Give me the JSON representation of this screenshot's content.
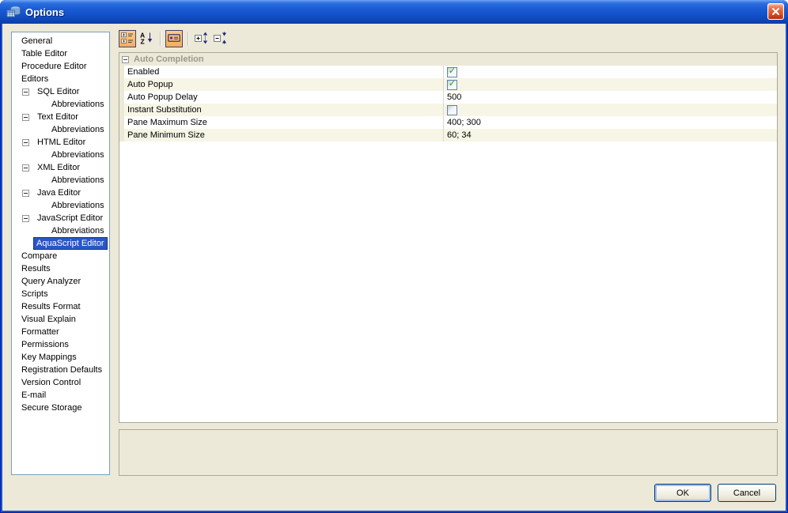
{
  "window": {
    "title": "Options"
  },
  "colors": {
    "titlebar_blue": "#1a55d2",
    "dialog_beige": "#ece9d8",
    "selection_blue": "#2a56c6",
    "toolbar_selected_orange": "#f6ad5c",
    "check_green": "#15a31b",
    "close_red": "#d84c20",
    "panel_border_gray": "#aca899",
    "tree_border_blue": "#7f9db9"
  },
  "icons": {
    "titlebar": "database-table-icon",
    "close": "close-x-icon",
    "tree_collapse": "minus-box-icon",
    "checkbox_checked": "green-check-icon",
    "toolbar": [
      "categorized-icon",
      "alphabetical-sort-icon",
      "show-description-icon",
      "expand-all-icon",
      "collapse-all-icon"
    ]
  },
  "toolbar": {
    "categorized_selected": true,
    "alphabetical_selected": false,
    "description_selected": true,
    "expand_selected": false,
    "collapse_selected": false
  },
  "tree": {
    "items": [
      {
        "label": "General",
        "level": "0"
      },
      {
        "label": "Table Editor",
        "level": "0"
      },
      {
        "label": "Procedure Editor",
        "level": "0"
      },
      {
        "label": "Editors",
        "level": "0"
      },
      {
        "label": "SQL Editor",
        "level": "1",
        "box": "minus"
      },
      {
        "label": "Abbreviations",
        "level": "2"
      },
      {
        "label": "Text Editor",
        "level": "1",
        "box": "minus"
      },
      {
        "label": "Abbreviations",
        "level": "2"
      },
      {
        "label": "HTML Editor",
        "level": "1",
        "box": "minus"
      },
      {
        "label": "Abbreviations",
        "level": "2"
      },
      {
        "label": "XML Editor",
        "level": "1",
        "box": "minus"
      },
      {
        "label": "Abbreviations",
        "level": "2"
      },
      {
        "label": "Java Editor",
        "level": "1",
        "box": "minus"
      },
      {
        "label": "Abbreviations",
        "level": "2"
      },
      {
        "label": "JavaScript Editor",
        "level": "1",
        "box": "minus"
      },
      {
        "label": "Abbreviations",
        "level": "2"
      },
      {
        "label": "AquaScript Editor",
        "level": "1b",
        "selected": true
      },
      {
        "label": "Compare",
        "level": "0"
      },
      {
        "label": "Results",
        "level": "0"
      },
      {
        "label": "Query Analyzer",
        "level": "0"
      },
      {
        "label": "Scripts",
        "level": "0"
      },
      {
        "label": "Results Format",
        "level": "0"
      },
      {
        "label": "Visual Explain",
        "level": "0"
      },
      {
        "label": "Formatter",
        "level": "0"
      },
      {
        "label": "Permissions",
        "level": "0"
      },
      {
        "label": "Key Mappings",
        "level": "0"
      },
      {
        "label": "Registration Defaults",
        "level": "0"
      },
      {
        "label": "Version Control",
        "level": "0"
      },
      {
        "label": "E-mail",
        "level": "0"
      },
      {
        "label": "Secure Storage",
        "level": "0"
      }
    ]
  },
  "property_grid": {
    "category": "Auto Completion",
    "rows": [
      {
        "name": "Enabled",
        "type": "checkbox",
        "checked": true
      },
      {
        "name": "Auto Popup",
        "type": "checkbox",
        "checked": true
      },
      {
        "name": "Auto Popup Delay",
        "type": "text",
        "value": "500"
      },
      {
        "name": "Instant Substitution",
        "type": "checkbox",
        "checked": false
      },
      {
        "name": "Pane Maximum Size",
        "type": "text",
        "value": "400; 300"
      },
      {
        "name": "Pane Minimum Size",
        "type": "text",
        "value": "60; 34"
      }
    ]
  },
  "description_panel": {
    "text": ""
  },
  "buttons": {
    "ok": "OK",
    "cancel": "Cancel"
  }
}
